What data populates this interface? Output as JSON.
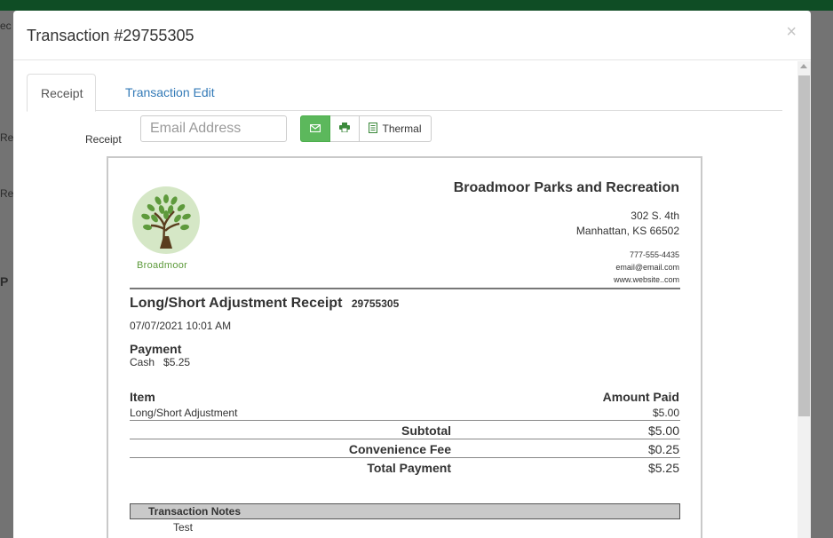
{
  "background": {
    "fragments": [
      "ec",
      "Re",
      "Rev",
      "P"
    ]
  },
  "modal": {
    "title": "Transaction #29755305",
    "close": "×"
  },
  "tabs": [
    {
      "label": "Receipt",
      "active": true
    },
    {
      "label": "Transaction Edit",
      "active": false
    }
  ],
  "toolbar": {
    "label": "Receipt",
    "email_placeholder": "Email Address",
    "thermal_label": "Thermal"
  },
  "receipt": {
    "logo_text": "Broadmoor",
    "org_name": "Broadmoor Parks and Recreation",
    "address_line1": "302 S. 4th",
    "address_line2": "Manhattan, KS 66502",
    "phone": "777-555-4435",
    "email": "email@email.com",
    "website": "www.website..com",
    "title": "Long/Short Adjustment Receipt",
    "number": "29755305",
    "date": "07/07/2021 10:01 AM",
    "payment_heading": "Payment",
    "payment_detail": "Cash   $5.25",
    "item_heading": "Item",
    "amount_heading": "Amount Paid",
    "items": [
      {
        "name": "Long/Short Adjustment",
        "amount": "$5.00"
      }
    ],
    "subtotal_label": "Subtotal",
    "subtotal": "$5.00",
    "fee_label": "Convenience Fee",
    "fee": "$0.25",
    "total_label": "Total Payment",
    "total": "$5.25",
    "notes_heading": "Transaction Notes",
    "notes": "Test"
  },
  "colors": {
    "brand_green": "#0f4d25",
    "email_button": "#5cb85c",
    "link": "#337ab7",
    "logo_green": "#5c9a3a"
  }
}
